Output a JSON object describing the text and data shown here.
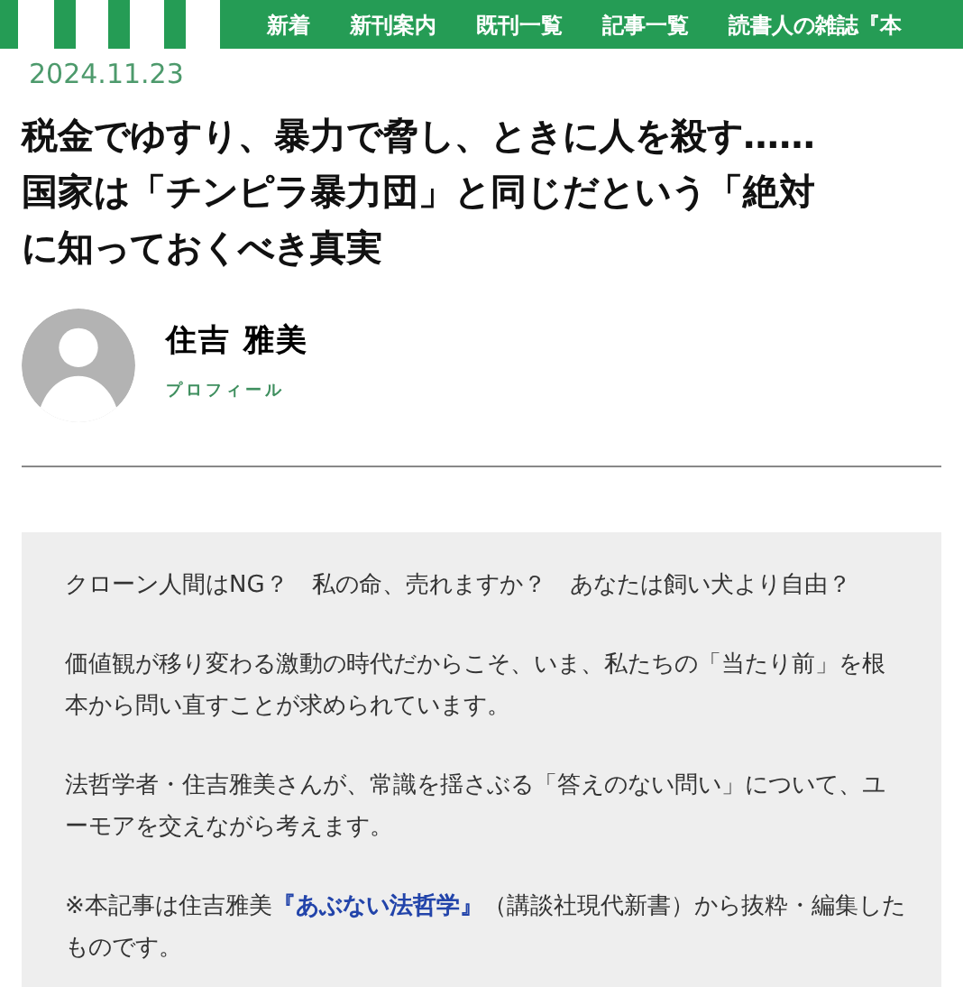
{
  "nav": {
    "items": [
      "新着",
      "新刊案内",
      "既刊一覧",
      "記事一覧",
      "読書人の雑誌『本"
    ]
  },
  "article": {
    "date": "2024.11.23",
    "title_lines": [
      "税金でゆすり、暴力で脅し、ときに人を殺す……",
      "国家は「チンピラ暴力団」と同じだという「絶対",
      "に知っておくべき真実"
    ],
    "author": {
      "name": "住吉 雅美",
      "profile_link": "プロフィール"
    },
    "lead": [
      "クローン人間はNG？　私の命、売れますか？　あなたは飼い犬より自由？",
      "価値観が移り変わる激動の時代だからこそ、いま、私たちの「当たり前」を根本から問い直すことが求められています。",
      "法哲学者・住吉雅美さんが、常識を揺さぶる「答えのない問い」について、ユーモアを交えながら考えます。"
    ],
    "note": {
      "before": "※本記事は住吉雅美",
      "link": "『あぶない法哲学』",
      "after": "（講談社現代新書）から抜粋・編集したものです。"
    }
  }
}
